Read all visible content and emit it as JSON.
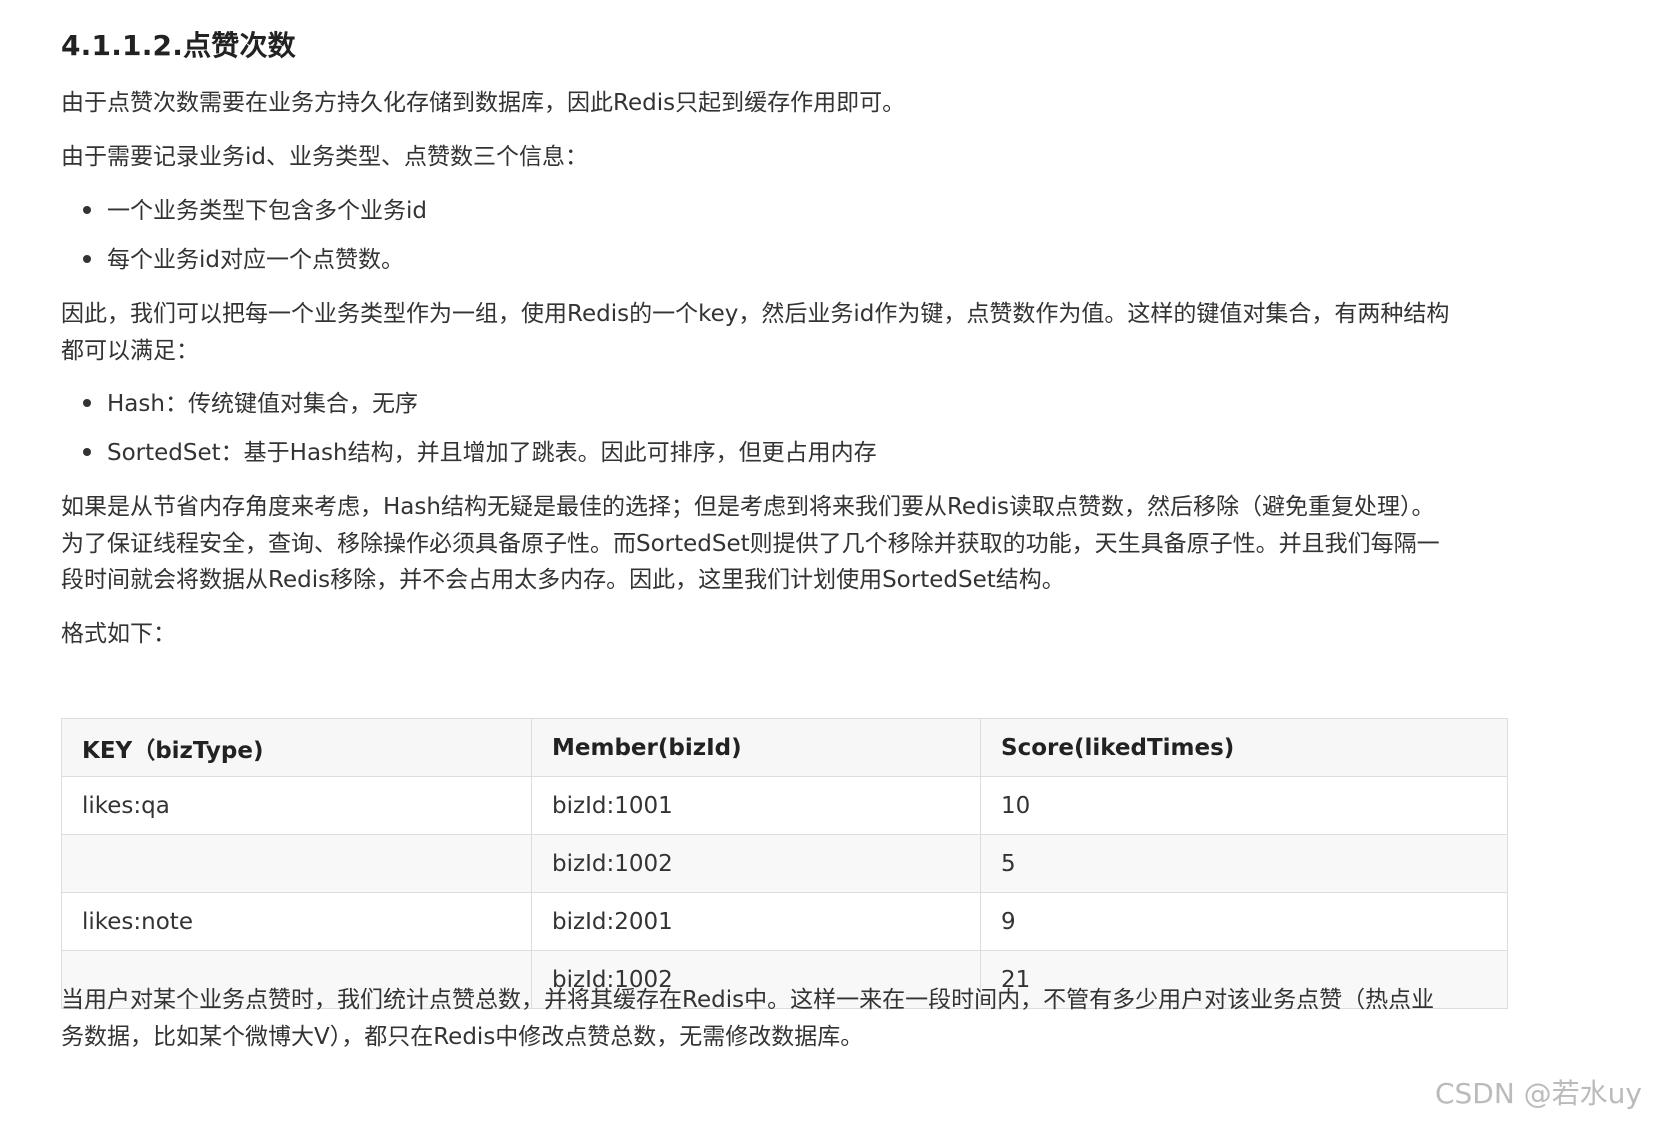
{
  "heading": "4.1.1.2.点赞次数",
  "paragraphs": {
    "p1": "由于点赞次数需要在业务方持久化存储到数据库，因此Redis只起到缓存作用即可。",
    "p2": "由于需要记录业务id、业务类型、点赞数三个信息：",
    "p3_line1": "因此，我们可以把每一个业务类型作为一组，使用Redis的一个key，然后业务id作为键，点赞数作为值。这样的键值对集合，有两种结构",
    "p3_line2": "都可以满足：",
    "p4_line1": "如果是从节省内存角度来考虑，Hash结构无疑是最佳的选择；但是考虑到将来我们要从Redis读取点赞数，然后移除（避免重复处理）。",
    "p4_line2": "为了保证线程安全，查询、移除操作必须具备原子性。而SortedSet则提供了几个移除并获取的功能，天生具备原子性。并且我们每隔一",
    "p4_line3": "段时间就会将数据从Redis移除，并不会占用太多内存。因此，这里我们计划使用SortedSet结构。",
    "p5": "格式如下：",
    "p6_line1": "当用户对某个业务点赞时，我们统计点赞总数，并将其缓存在Redis中。这样一来在一段时间内，不管有多少用户对该业务点赞（热点业",
    "p6_line2": "务数据，比如某个微博大V），都只在Redis中修改点赞总数，无需修改数据库。"
  },
  "list1": [
    "一个业务类型下包含多个业务id",
    "每个业务id对应一个点赞数。"
  ],
  "list2": [
    "Hash：传统键值对集合，无序",
    "SortedSet：基于Hash结构，并且增加了跳表。因此可排序，但更占用内存"
  ],
  "table": {
    "headers": [
      "KEY（bizType)",
      "Member(bizId)",
      "Score(likedTimes)"
    ],
    "rows": [
      [
        "likes:qa",
        "bizId:1001",
        "10"
      ],
      [
        "",
        "bizId:1002",
        "5"
      ],
      [
        "likes:note",
        "bizId:2001",
        "9"
      ],
      [
        "",
        "bizId:1002",
        "21"
      ]
    ]
  },
  "watermark": "CSDN @若水uy"
}
